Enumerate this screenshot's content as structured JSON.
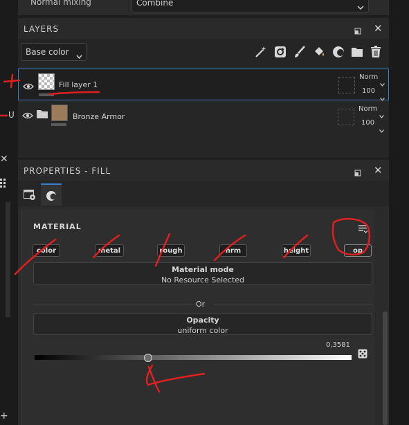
{
  "top": {
    "mixing_label": "Normal mixing",
    "mixing_value": "Combine"
  },
  "left_panel": {
    "u_label": "U",
    "close": "✕",
    "plus": "+"
  },
  "layers": {
    "title": "LAYERS",
    "base_color": "Base color",
    "toolbar_icons": [
      "magic-wand-icon",
      "refresh-icon",
      "brush-icon",
      "fill-bucket-icon",
      "mask-icon",
      "folder-icon",
      "trash-icon"
    ],
    "items": [
      {
        "name": "Fill layer 1",
        "blend": "Norm",
        "opacity": "100",
        "selected": true
      },
      {
        "name": "Bronze Armor",
        "blend": "Norm",
        "opacity": "100",
        "selected": false,
        "thumb_color": "#9b7b5a"
      }
    ]
  },
  "properties": {
    "title": "PROPERTIES - FILL",
    "material_title": "MATERIAL",
    "channels": [
      "color",
      "metal",
      "rough",
      "nrm",
      "height",
      "op"
    ],
    "material_mode": {
      "title": "Material mode",
      "subtitle": "No Resource Selected"
    },
    "or_label": "Or",
    "opacity_slot": {
      "title": "Opacity",
      "subtitle": "uniform color"
    },
    "value_readout": "0,3581",
    "slider_fraction": 0.3581
  },
  "colors": {
    "accent": "#3a7cc9",
    "annotation_red": "#e02020"
  }
}
